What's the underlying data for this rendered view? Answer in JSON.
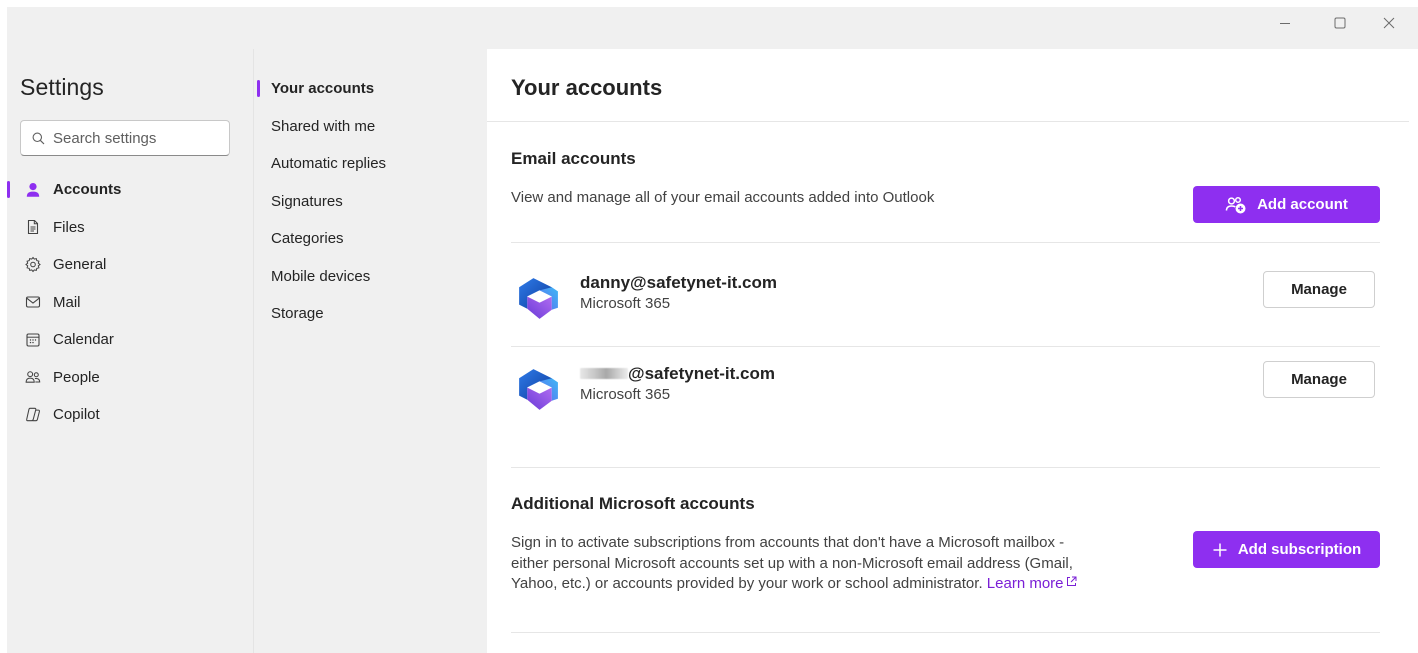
{
  "settings": {
    "title": "Settings",
    "search_placeholder": "Search settings",
    "accent": "#8e2ff0",
    "categories": [
      {
        "label": "Accounts",
        "icon": "person-icon",
        "active": true
      },
      {
        "label": "Files",
        "icon": "file-icon",
        "active": false
      },
      {
        "label": "General",
        "icon": "gear-icon",
        "active": false
      },
      {
        "label": "Mail",
        "icon": "mail-icon",
        "active": false
      },
      {
        "label": "Calendar",
        "icon": "calendar-icon",
        "active": false
      },
      {
        "label": "People",
        "icon": "people-icon",
        "active": false
      },
      {
        "label": "Copilot",
        "icon": "copilot-icon",
        "active": false
      }
    ]
  },
  "subnav": {
    "items": [
      {
        "label": "Your accounts",
        "active": true
      },
      {
        "label": "Shared with me",
        "active": false
      },
      {
        "label": "Automatic replies",
        "active": false
      },
      {
        "label": "Signatures",
        "active": false
      },
      {
        "label": "Categories",
        "active": false
      },
      {
        "label": "Mobile devices",
        "active": false
      },
      {
        "label": "Storage",
        "active": false
      }
    ]
  },
  "main": {
    "title": "Your accounts",
    "email_section": {
      "title": "Email accounts",
      "description": "View and manage all of your email accounts added into Outlook",
      "add_button": "Add account",
      "accounts": [
        {
          "email": "danny@safetynet-it.com",
          "type": "Microsoft 365",
          "manage_label": "Manage",
          "redacted_prefix": false
        },
        {
          "email": "@safetynet-it.com",
          "type": "Microsoft 365",
          "manage_label": "Manage",
          "redacted_prefix": true
        }
      ]
    },
    "additional_section": {
      "title": "Additional Microsoft accounts",
      "description_line1": "Sign in to activate subscriptions from accounts that don't have a Microsoft mailbox -",
      "description_line2": "either personal Microsoft accounts set up with a non-Microsoft email address (Gmail,",
      "description_line3": "Yahoo, etc.) or accounts provided by your work or school administrator.",
      "learn_more": "Learn more",
      "add_button": "Add subscription"
    }
  }
}
